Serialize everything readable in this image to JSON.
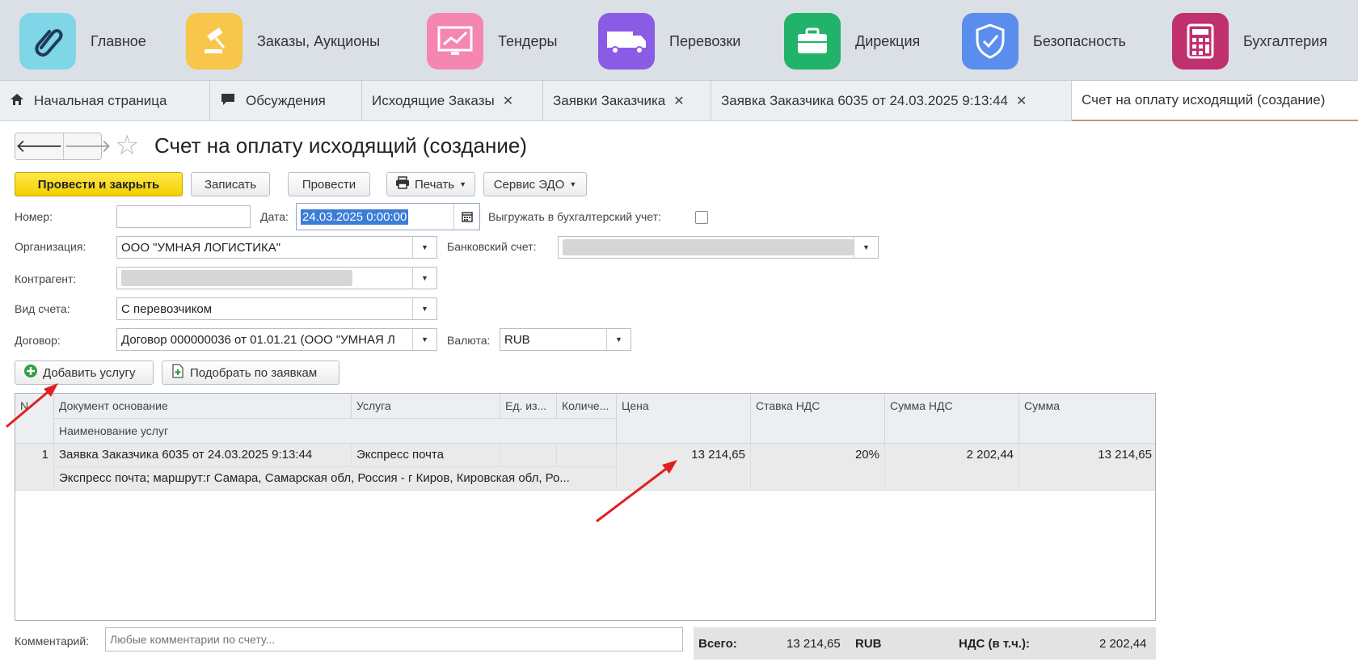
{
  "sections": [
    {
      "label": "Главное",
      "icon": "clip-logo-icon",
      "color": "#7ed6e6"
    },
    {
      "label": "Заказы, Аукционы",
      "icon": "gavel-icon",
      "color": "#f7c64a"
    },
    {
      "label": "Тендеры",
      "icon": "chart-monitor-icon",
      "color": "#f586b0"
    },
    {
      "label": "Перевозки",
      "icon": "truck-icon",
      "color": "#8a5ce6"
    },
    {
      "label": "Дирекция",
      "icon": "briefcase-icon",
      "color": "#21b36a"
    },
    {
      "label": "Безопасность",
      "icon": "shield-check-icon",
      "color": "#5a8ded"
    },
    {
      "label": "Бухгалтерия",
      "icon": "calculator-icon",
      "color": "#c0306e"
    }
  ],
  "tabs": [
    {
      "label": "Начальная страница",
      "icon": "home-icon",
      "closable": false
    },
    {
      "label": "Обсуждения",
      "icon": "chat-icon",
      "closable": false
    },
    {
      "label": "Исходящие Заказы",
      "closable": true
    },
    {
      "label": "Заявки Заказчика",
      "closable": true
    },
    {
      "label": "Заявка Заказчика 6035 от 24.03.2025 9:13:44",
      "closable": true
    },
    {
      "label": "Счет на оплату исходящий (создание)",
      "closable": false,
      "active": true
    }
  ],
  "nav": {
    "back": "🡐",
    "forward": "🡒"
  },
  "page": {
    "title": "Счет на оплату исходящий (создание)"
  },
  "toolbar": {
    "post_close": "Провести и закрыть",
    "save": "Записать",
    "post": "Провести",
    "print": "Печать",
    "edo": "Сервис ЭДО"
  },
  "form": {
    "number_label": "Номер:",
    "number_value": "",
    "date_label": "Дата:",
    "date_value": "24.03.2025  0:00:00",
    "export_label": "Выгружать в бухгалтерский учет:",
    "org_label": "Организация:",
    "org_value": "ООО \"УМНАЯ ЛОГИСТИКА\"",
    "bank_label": "Банковский счет:",
    "contractor_label": "Контрагент:",
    "invoice_type_label": "Вид счета:",
    "invoice_type_value": "С перевозчиком",
    "contract_label": "Договор:",
    "contract_value": "Договор 000000036 от 01.01.21 (ООО \"УМНАЯ Л",
    "currency_label": "Валюта:",
    "currency_value": "RUB"
  },
  "actions": {
    "add_service": "Добавить услугу",
    "pick_by_orders": "Подобрать по заявкам"
  },
  "table": {
    "headers": {
      "num": "N",
      "doc": "Документ основание",
      "service": "Услуга",
      "unit": "Ед. из...",
      "qty": "Количе...",
      "price": "Цена",
      "vat_rate": "Ставка НДС",
      "vat_sum": "Сумма НДС",
      "sum": "Сумма",
      "service_name": "Наименование услуг"
    },
    "rows": [
      {
        "num": "1",
        "doc": "Заявка Заказчика 6035 от 24.03.2025 9:13:44",
        "service": "Экспресс почта",
        "unit": "",
        "qty": "",
        "price": "13 214,65",
        "vat_rate": "20%",
        "vat_sum": "2 202,44",
        "sum": "13 214,65",
        "service_name": "Экспресс почта; маршрут:г Самара, Самарская обл, Россия - г Киров, Кировская обл, Ро..."
      }
    ]
  },
  "footer": {
    "comment_label": "Комментарий:",
    "comment_placeholder": "Любые комментарии по счету...",
    "total_label": "Всего:",
    "total_value": "13 214,65",
    "total_currency": "RUB",
    "vat_label": "НДС (в т.ч.):",
    "vat_value": "2 202,44"
  },
  "colors": {
    "primary_button": "#f3cf00",
    "annotation_arrow": "#e02020"
  }
}
